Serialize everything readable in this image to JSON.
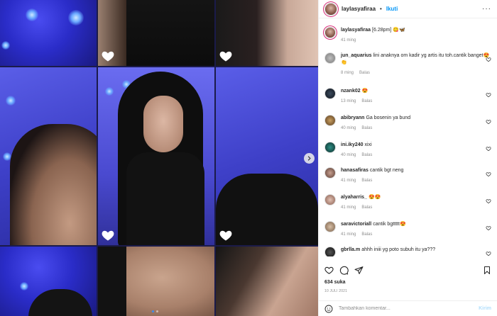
{
  "header": {
    "username": "laylasyafiraa",
    "separator": "•",
    "follow_label": "Ikuti",
    "more_icon": "more-dots-icon"
  },
  "caption": {
    "username": "laylasyafiraa",
    "text": "[6.28pm] 😋🦋",
    "time": "41 ming"
  },
  "comments": [
    {
      "username": "jun_aquarius",
      "text": "lini anaknya om kadir yg artis itu toh.cantik banget😍👏",
      "time": "8 ming",
      "reply": "Balas"
    },
    {
      "username": "nzank02",
      "text": "😍",
      "time": "13 ming",
      "reply": "Balas"
    },
    {
      "username": "abibryann",
      "text": "Ga bosenin ya bund",
      "time": "40 ming",
      "reply": "Balas"
    },
    {
      "username": "ini.iky240",
      "text": "xixi",
      "time": "40 ming",
      "reply": "Balas"
    },
    {
      "username": "hanasafiras",
      "text": "cantik bgt neng",
      "time": "41 ming",
      "reply": "Balas"
    },
    {
      "username": "alyaharris_",
      "text": "😍😍",
      "time": "41 ming",
      "reply": "Balas"
    },
    {
      "username": "saravictoriall",
      "text": "cantik bgttttt😍",
      "time": "41 ming",
      "reply": "Balas"
    },
    {
      "username": "gbrlla.m",
      "text": "ahhh iniii yg poto subuh itu ya???",
      "time": "",
      "reply": ""
    }
  ],
  "actions": {
    "like_icon": "heart-icon",
    "comment_icon": "comment-icon",
    "share_icon": "share-icon",
    "save_icon": "bookmark-icon"
  },
  "likes": "634 suka",
  "date": "10 JULI 2021",
  "add_comment": {
    "placeholder": "Tambahkan komentar...",
    "post_label": "Kirim",
    "emoji_icon": "smiley-icon"
  },
  "colors": {
    "link": "#0095f6",
    "text": "#262626",
    "muted": "#8e8e8e",
    "post_disabled": "#b2dffc"
  }
}
